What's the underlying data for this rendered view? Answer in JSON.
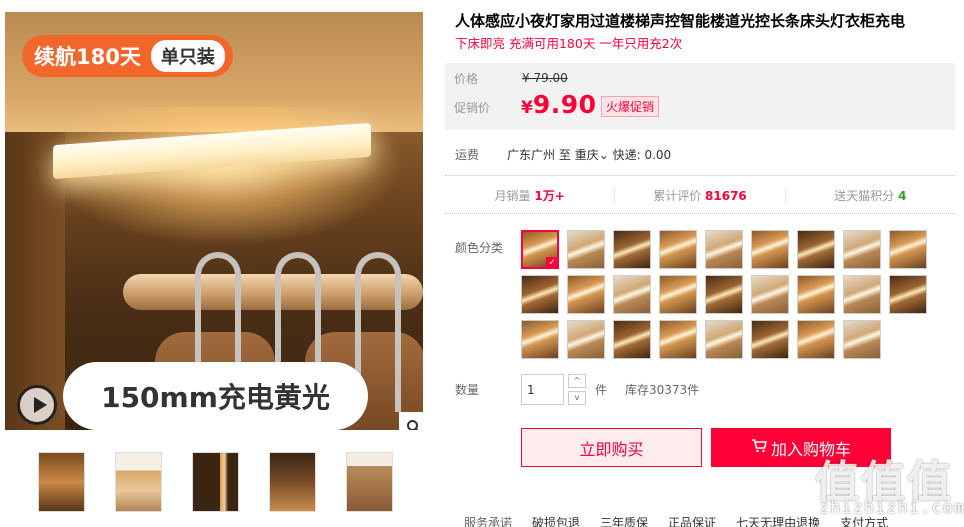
{
  "gallery": {
    "badge_main": "续航180天",
    "badge_pill": "单只装",
    "caption": "150mm充电黄光",
    "zoom_icon": "search-icon",
    "play_icon": "play-icon",
    "thumbnail_count": 5
  },
  "product": {
    "title": "人体感应小夜灯家用过道楼梯声控智能楼道光控长条床头灯衣柜充电",
    "subtitle": "下床即亮 充满可用180天 一年只用充2次"
  },
  "price": {
    "label_price": "价格",
    "original": "¥ 79.00",
    "label_promo": "促销价",
    "currency": "¥",
    "promo": "9.90",
    "hot_tag": "火爆促销"
  },
  "shipping": {
    "label": "运费",
    "from": "广东广州",
    "to_word": "至",
    "to": "重庆",
    "method": "快递: 0.00"
  },
  "stats": {
    "monthly_label": "月销量",
    "monthly_value": "1万+",
    "reviews_label": "累计评价",
    "reviews_value": "81676",
    "points_label": "送天猫积分",
    "points_value": "4"
  },
  "sku": {
    "label": "颜色分类",
    "swatch_count": 26,
    "selected_index": 0
  },
  "quantity": {
    "label": "数量",
    "value": "1",
    "up": "^",
    "down": "v",
    "unit": "件",
    "stock": "库存30373件"
  },
  "actions": {
    "buy_now": "立即购买",
    "add_to_cart": "加入购物车",
    "cart_icon": "cart-icon"
  },
  "services": {
    "label": "服务承诺",
    "items": [
      "破损包退",
      "三年质保",
      "正品保证",
      "七天无理由退换",
      "支付方式"
    ]
  },
  "watermark": {
    "glyphs": "值值值",
    "text": "zhizhizhi.com"
  },
  "colors": {
    "accent": "#ff0036",
    "badge_orange": "#f2652b",
    "points_green": "#3a9a32"
  }
}
